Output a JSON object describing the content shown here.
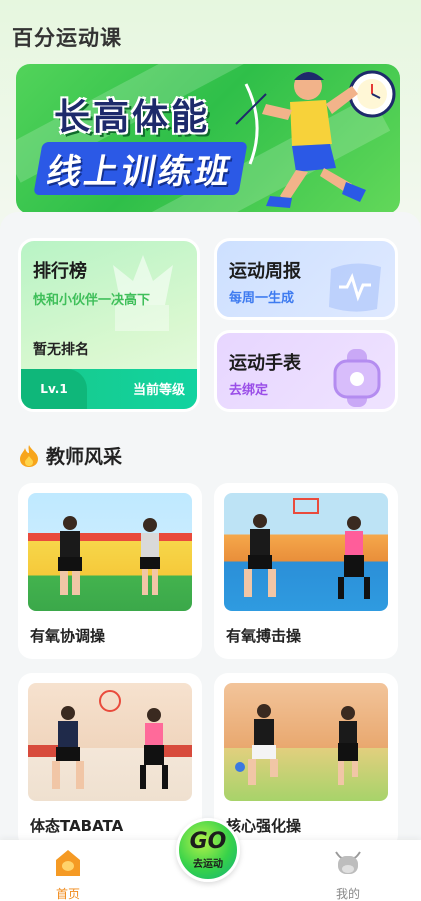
{
  "app": {
    "title": "百分运动课"
  },
  "banner": {
    "line1": "长高体能",
    "line2": "线上训练班"
  },
  "cards": {
    "ranking": {
      "title": "排行榜",
      "subtitle": "快和小伙伴一决高下",
      "status": "暂无排名",
      "level": "Lv.1",
      "level_label": "当前等级"
    },
    "weekly_report": {
      "title": "运动周报",
      "subtitle": "每周一生成"
    },
    "watch": {
      "title": "运动手表",
      "subtitle": "去绑定"
    }
  },
  "section": {
    "title": "教师风采"
  },
  "videos": [
    {
      "label": "有氧协调操"
    },
    {
      "label": "有氧搏击操"
    },
    {
      "label": "体态TABATA"
    },
    {
      "label": "核心强化操"
    }
  ],
  "nav": {
    "home": "首页",
    "go_text": "GO",
    "go_label": "去运动",
    "mine": "我的"
  },
  "colors": {
    "accent_green": "#12c98e",
    "ranking_sub": "#3fbf5a",
    "report_sub": "#3e7bf0",
    "watch_sub": "#9a4ee8",
    "home_active": "#f08a1a",
    "nav_inactive": "#888888"
  }
}
